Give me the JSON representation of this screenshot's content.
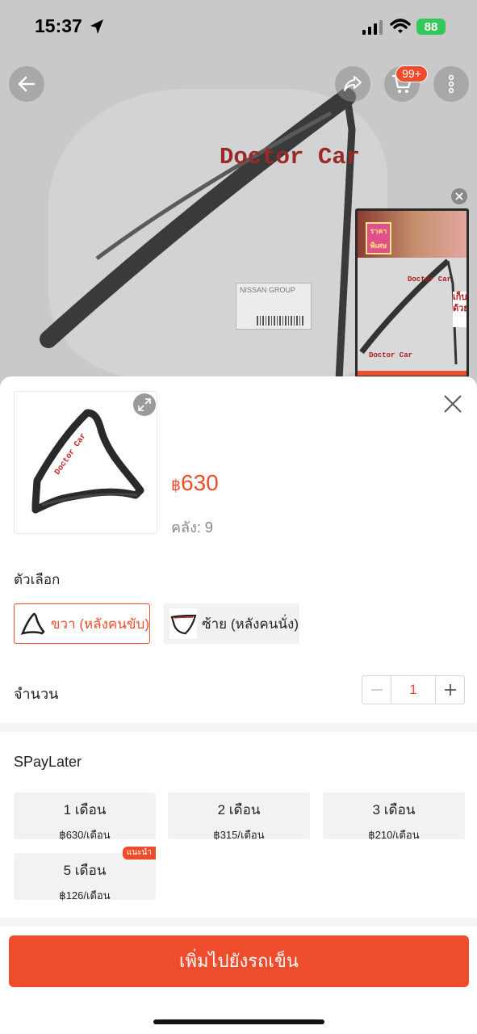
{
  "status_bar": {
    "time": "15:37",
    "battery": "88"
  },
  "nav": {
    "cart_badge": "99+"
  },
  "background": {
    "watermark": "Doctor Car",
    "label_text": "NISSAN GROUP"
  },
  "mini_player": {
    "tag": "ราคาพิเศษ",
    "watermark": "Doctor Car",
    "side_text": "เก็บด้วย"
  },
  "product": {
    "price_currency": "฿",
    "price_amount": "630",
    "stock_label": "คลัง:",
    "stock_value": "9",
    "watermark": "Doctor Car"
  },
  "options": {
    "label": "ตัวเลือก",
    "items": [
      {
        "label": "ขวา (หลังคนขับ)",
        "selected": true
      },
      {
        "label": "ซ้าย (หลังคนนั่ง)",
        "selected": false
      }
    ]
  },
  "quantity": {
    "label": "จำนวน",
    "value": "1"
  },
  "spaylater": {
    "title": "SPayLater",
    "plans": [
      {
        "months": "1 เดือน",
        "amount": "฿630/เดือน",
        "badge": ""
      },
      {
        "months": "2 เดือน",
        "amount": "฿315/เดือน",
        "badge": ""
      },
      {
        "months": "3 เดือน",
        "amount": "฿210/เดือน",
        "badge": ""
      },
      {
        "months": "5 เดือน",
        "amount": "฿126/เดือน",
        "badge": "แนะนำ"
      }
    ]
  },
  "cta": {
    "label": "เพิ่มไปยังรถเข็น"
  },
  "colors": {
    "accent": "#ee4d2d",
    "battery": "#34c759"
  },
  "icons": [
    "location-arrow-icon",
    "signal-icon",
    "wifi-icon",
    "back-arrow-icon",
    "share-icon",
    "cart-icon",
    "more-icon",
    "close-icon",
    "expand-icon",
    "minus-icon",
    "plus-icon"
  ]
}
